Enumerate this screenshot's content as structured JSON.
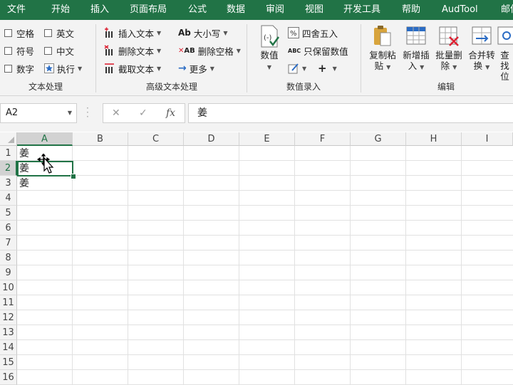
{
  "tabs": [
    "文件",
    "开始",
    "插入",
    "页面布局",
    "公式",
    "数据",
    "审阅",
    "视图",
    "开发工具",
    "帮助",
    "AudTool",
    "邮件"
  ],
  "ribbon": {
    "text_processing": {
      "label": "文本处理",
      "items": [
        "空格",
        "英文",
        "符号",
        "中文",
        "数字",
        "执行"
      ]
    },
    "advanced_text": {
      "label": "高级文本处理",
      "insert_text": "插入文本",
      "delete_text": "删除文本",
      "extract_text": "截取文本",
      "case": "大小写",
      "delete_space": "删除空格",
      "more": "更多",
      "case_icon_text": "Ab",
      "space_icon_text": "AB"
    },
    "numeric_entry": {
      "label": "数值录入",
      "value": "数值",
      "round": "四舍五入",
      "keep_value": "只保留数值",
      "abc_icon_text": "ABC",
      "plus": "+"
    },
    "edit": {
      "label": "编辑",
      "copy_paste": [
        "复制粘",
        "贴"
      ],
      "new_insert": [
        "新增插",
        "入"
      ],
      "batch_delete": [
        "批量删",
        "除"
      ],
      "merge_convert": [
        "合并转",
        "换"
      ],
      "lookup": [
        "查找",
        "位"
      ]
    }
  },
  "formula_bar": {
    "name_box": "A2",
    "cancel": "✕",
    "enter": "✓",
    "fx": "fx",
    "content": "姜"
  },
  "grid": {
    "columns": [
      "A",
      "B",
      "C",
      "D",
      "E",
      "F",
      "G",
      "H",
      "I"
    ],
    "rows": [
      "1",
      "2",
      "3",
      "4",
      "5",
      "6",
      "7",
      "8",
      "9",
      "10",
      "11",
      "12",
      "13",
      "14",
      "15",
      "16"
    ],
    "cells": {
      "A1": "姜",
      "A2": "姜",
      "A3": "姜"
    },
    "selected_cell": "A2",
    "selected_column": "A",
    "selected_row": "2"
  },
  "colors": {
    "accent": "#217346",
    "ribbon_bg": "#f3f3f3",
    "header_sel": "#d2d2d2"
  }
}
